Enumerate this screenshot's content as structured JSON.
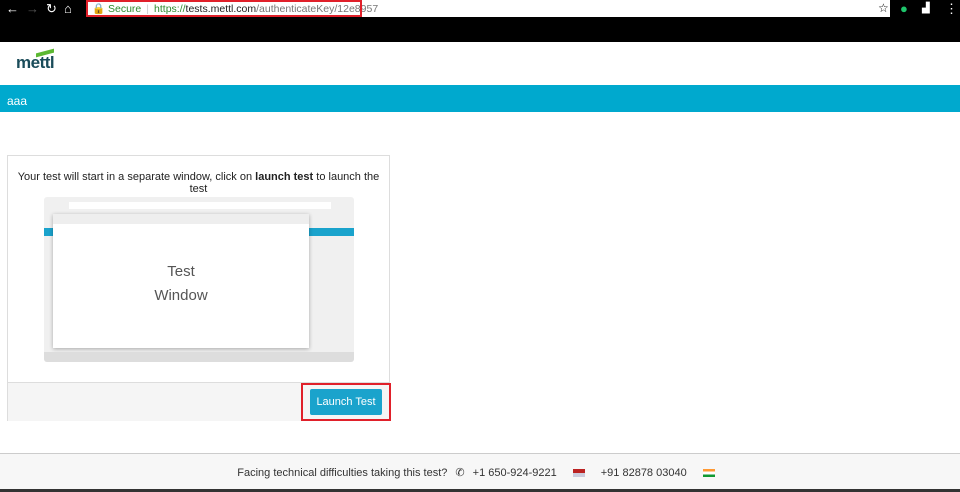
{
  "browser": {
    "secure_label": "Secure",
    "url_scheme": "https://",
    "url_host": "tests.mettl.com",
    "url_path": "/authenticateKey/12e8957"
  },
  "header": {
    "logo": "mettl"
  },
  "band": {
    "title": "aaa"
  },
  "card": {
    "message_pre": "Your test will start in a separate window, click on ",
    "message_bold": "launch test",
    "message_post": " to launch the test",
    "mock_line1": "Test",
    "mock_line2": "Window",
    "launch_label": "Launch Test"
  },
  "footer": {
    "text": "Facing technical difficulties taking this test?",
    "us_phone": "+1 650-924-9221",
    "in_phone": "+91 82878 03040"
  }
}
